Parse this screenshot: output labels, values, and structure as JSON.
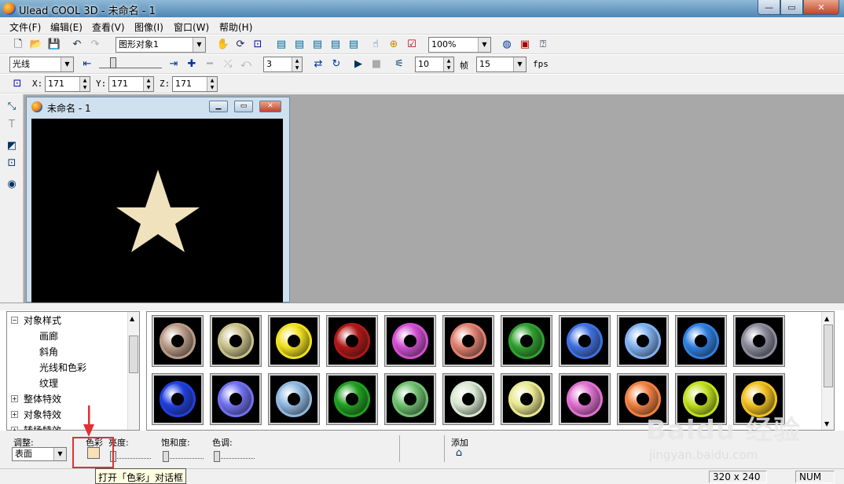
{
  "window": {
    "title": "Ulead COOL 3D - 未命名 - 1"
  },
  "menu": [
    "文件(F)",
    "编辑(E)",
    "查看(V)",
    "图像(I)",
    "窗口(W)",
    "帮助(H)"
  ],
  "toolbar1": {
    "object_select": "图形对象1",
    "zoom": "100%"
  },
  "toolbar2": {
    "light_select": "光线",
    "frame_value": "3",
    "frame_count": "10",
    "frame_label": "帧",
    "fps_value": "15",
    "fps_label": "fps"
  },
  "toolbar3": {
    "x_label": "X:",
    "x_value": "171",
    "y_label": "Y:",
    "y_value": "171",
    "z_label": "Z:",
    "z_value": "171"
  },
  "document": {
    "title": "未命名 - 1",
    "star_color": "#f0e2bd"
  },
  "tree": {
    "items": [
      {
        "label": "对象样式",
        "expander": "⊟"
      },
      {
        "label": "画廊"
      },
      {
        "label": "斜角"
      },
      {
        "label": "光线和色彩"
      },
      {
        "label": "纹理"
      },
      {
        "label": "整体特效",
        "expander": "⊞"
      },
      {
        "label": "对象特效",
        "expander": "⊞"
      },
      {
        "label": "转场特效",
        "expander": "⊞"
      }
    ]
  },
  "gallery": {
    "row1": [
      "#b89a86",
      "#c8c08a",
      "#f0e020",
      "#b01818",
      "#d050d0",
      "#e08070",
      "#30a030",
      "#4070e0",
      "#80b0f0",
      "#3080e0",
      "#8a8a9a"
    ],
    "row2": [
      "#2040e0",
      "#7070f0",
      "#90b8e0",
      "#20a020",
      "#70c070",
      "#d8e8d0",
      "#e8e890",
      "#e070d0",
      "#f08040",
      "#c0e020",
      "#f0c020"
    ]
  },
  "bottom": {
    "adjust_label": "调整:",
    "adjust_value": "表面",
    "color_label": "色彩",
    "brightness_label": "亮度:",
    "saturation_label": "饱和度:",
    "hue_label": "色调:",
    "add_label": "添加"
  },
  "tooltip": "打开「色彩」对话框",
  "status": {
    "size": "320 x 240",
    "num": "NUM"
  },
  "watermark": {
    "brand": "Baidu 经验",
    "url": "jingyan.baidu.com"
  },
  "colors": {
    "title_gradient_top": "#8fb8d6",
    "title_gradient_bottom": "#4f86b3",
    "highlight_red": "#e03030"
  }
}
